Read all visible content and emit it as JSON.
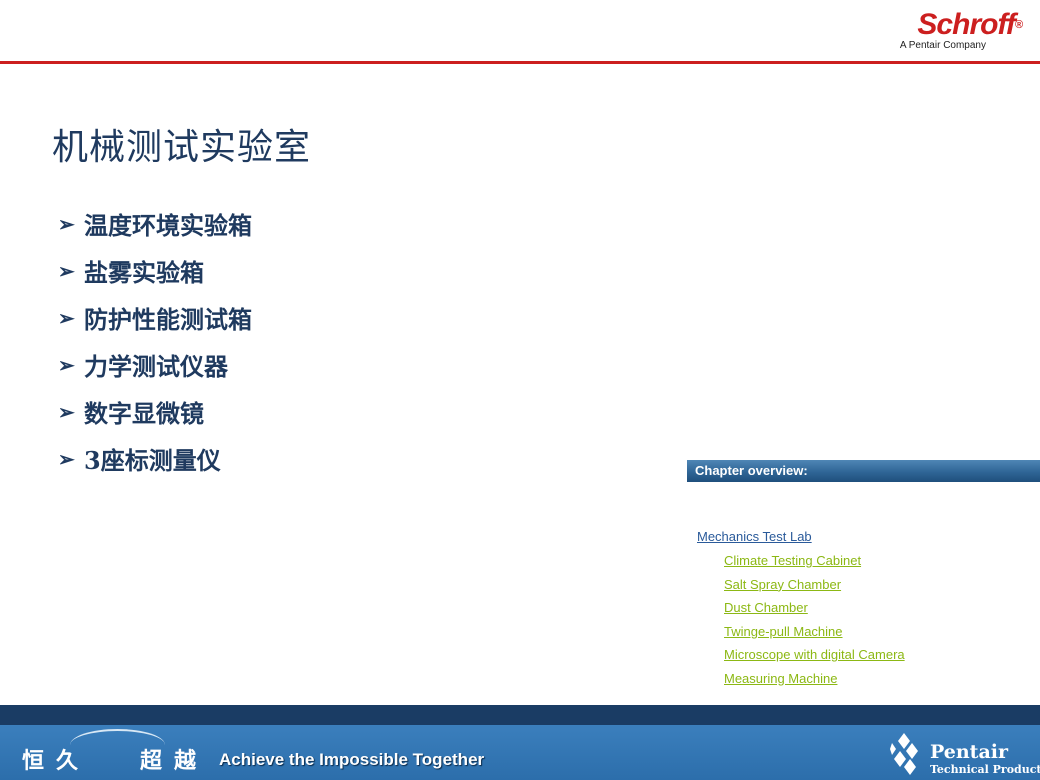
{
  "header": {
    "logo_word": "Schroff",
    "logo_reg": "®",
    "logo_sub": "A Pentair Company"
  },
  "slide": {
    "title": "机械测试实验室",
    "bullets": [
      {
        "label": "温度环境实验箱"
      },
      {
        "label": "盐雾实验箱"
      },
      {
        "label": "防护性能测试箱"
      },
      {
        "label": "力学测试仪器"
      },
      {
        "label": "数字显微镜"
      },
      {
        "label": "3座标测量仪"
      }
    ]
  },
  "overview": {
    "heading": "Chapter overview:",
    "main_link": "Mechanics Test Lab",
    "sub_links": [
      {
        "label": "Climate Testing Cabinet"
      },
      {
        "label": "Salt Spray Chamber"
      },
      {
        "label": "Dust Chamber"
      },
      {
        "label": "Twinge-pull Machine"
      },
      {
        "label": "Microscope with digital Camera"
      },
      {
        "label": "Measuring Machine"
      }
    ]
  },
  "footer": {
    "motto_cn": [
      "恒",
      "久",
      "超",
      "越"
    ],
    "motto_en": "Achieve the Impossible Together",
    "brand_name": "Pentair",
    "brand_sub": "Technical Products"
  },
  "colors": {
    "accent_red": "#cc1f1f",
    "title_blue": "#1f3a5f",
    "link_blue": "#2a5a9a",
    "link_green": "#8cb814",
    "footer_dark": "#1a3c64",
    "footer_blue": "#2c6eab"
  }
}
